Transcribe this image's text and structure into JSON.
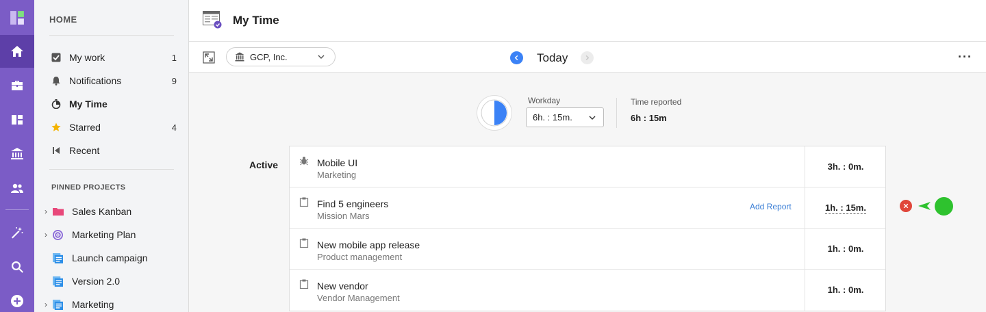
{
  "colors": {
    "rail": "#7b5cc6",
    "rail_active": "#5d3fa8",
    "accent": "#3b82f6",
    "stop": "#e0463a",
    "running": "#2ec22e"
  },
  "rail": {
    "items": [
      {
        "icon": "logo-icon"
      },
      {
        "icon": "home-icon"
      },
      {
        "icon": "briefcase-icon"
      },
      {
        "icon": "board-icon"
      },
      {
        "icon": "bank-icon"
      },
      {
        "icon": "people-icon"
      },
      {
        "icon": "magic-wand-icon"
      },
      {
        "icon": "search-icon"
      },
      {
        "icon": "add-icon"
      }
    ]
  },
  "sidebar": {
    "heading": "HOME",
    "items": [
      {
        "label": "My work",
        "count": "1",
        "icon": "checkbox-icon"
      },
      {
        "label": "Notifications",
        "count": "9",
        "icon": "bell-icon"
      },
      {
        "label": "My Time",
        "count": "",
        "icon": "timer-icon"
      },
      {
        "label": "Starred",
        "count": "4",
        "icon": "star-icon"
      },
      {
        "label": "Recent",
        "count": "",
        "icon": "recent-icon"
      }
    ],
    "pinned_heading": "PINNED PROJECTS",
    "projects": [
      {
        "label": "Sales Kanban",
        "icon": "folder-icon"
      },
      {
        "label": "Marketing Plan",
        "icon": "target-icon"
      },
      {
        "label": "Launch campaign",
        "icon": "list-icon"
      },
      {
        "label": "Version 2.0",
        "icon": "list-icon"
      },
      {
        "label": "Marketing",
        "icon": "list-icon"
      }
    ]
  },
  "header": {
    "title": "My Time"
  },
  "toolbar": {
    "org": "GCP, Inc.",
    "date_label": "Today",
    "more": "···"
  },
  "summary": {
    "workday_label": "Workday",
    "workday_value": "6h. : 15m.",
    "time_reported_label": "Time reported",
    "time_reported_value": "6h : 15m"
  },
  "active": {
    "label": "Active",
    "tasks": [
      {
        "name": "Mobile UI",
        "project": "Marketing",
        "time": "3h. : 0m.",
        "icon": "bug-icon",
        "add_report": ""
      },
      {
        "name": "Find 5 engineers",
        "project": "Mission Mars",
        "time": "1h. : 15m.",
        "icon": "clipboard-icon",
        "add_report": "Add Report"
      },
      {
        "name": "New mobile app release",
        "project": "Product management",
        "time": "1h. : 0m.",
        "icon": "clipboard-icon",
        "add_report": ""
      },
      {
        "name": "New vendor",
        "project": "Vendor Management",
        "time": "1h. : 0m.",
        "icon": "clipboard-icon",
        "add_report": ""
      }
    ]
  }
}
